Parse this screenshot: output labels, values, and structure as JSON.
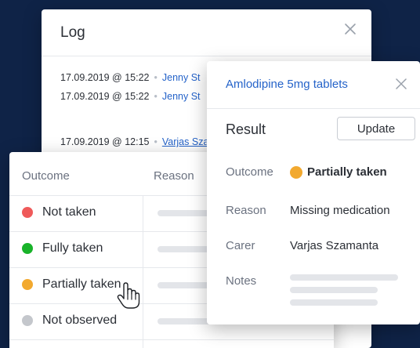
{
  "colors": {
    "background": "#0f2347",
    "link": "#2563c9",
    "red": "#ef5a5a",
    "green": "#19b32a",
    "amber": "#f2a92f",
    "grey": "#c4c7cc"
  },
  "log": {
    "title": "Log",
    "close_icon": "close-icon",
    "entries": [
      {
        "datetime": "17.09.2019 @ 15:22",
        "who": "Jenny St"
      },
      {
        "datetime": "17.09.2019 @ 15:22",
        "who": "Jenny St"
      },
      {
        "datetime": "17.09.2019 @ 12:15",
        "who": "Varjas Sza"
      }
    ]
  },
  "outcomes": {
    "headers": {
      "outcome": "Outcome",
      "reason": "Reason"
    },
    "rows": [
      {
        "label": "Not taken",
        "color": "#ef5a5a"
      },
      {
        "label": "Fully taken",
        "color": "#19b32a"
      },
      {
        "label": "Partially taken",
        "color": "#f2a92f"
      },
      {
        "label": "Not observed",
        "color": "#c4c7cc"
      }
    ],
    "cursor_icon": "hand-pointer-icon"
  },
  "detail": {
    "title": "Amlodipine 5mg tablets",
    "close_icon": "close-icon",
    "result_label": "Result",
    "update_label": "Update",
    "outcome_label": "Outcome",
    "outcome_value": "Partially taken",
    "outcome_color": "#f2a92f",
    "reason_label": "Reason",
    "reason_value": "Missing medication",
    "carer_label": "Carer",
    "carer_value": "Varjas Szamanta",
    "notes_label": "Notes"
  }
}
